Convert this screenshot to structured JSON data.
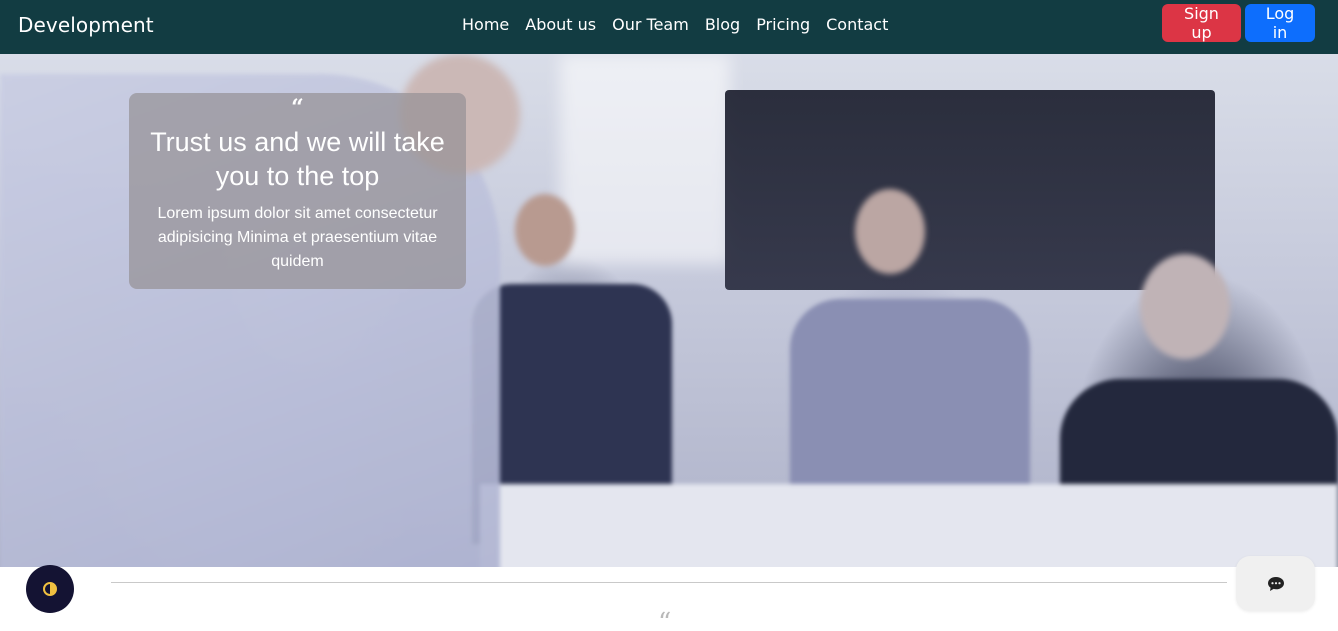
{
  "navbar": {
    "brand": "Development",
    "links": [
      "Home",
      "About us",
      "Our Team",
      "Blog",
      "Pricing",
      "Contact"
    ],
    "signup_label": "Sign up",
    "login_label": "Log in"
  },
  "hero": {
    "quote_mark": "“",
    "title": "Trust us and we will take you to the top",
    "text": "Lorem ipsum dolor sit amet consectetur adipisicing Minima et praesentium vitae quidem"
  },
  "below": {
    "quote_mark": "“"
  },
  "colors": {
    "navbar": "#123c42",
    "signup": "#dc3545",
    "login": "#0d6efd"
  },
  "icons": {
    "theme_toggle": "half-circle-icon",
    "chat": "chat-bubble-icon"
  }
}
